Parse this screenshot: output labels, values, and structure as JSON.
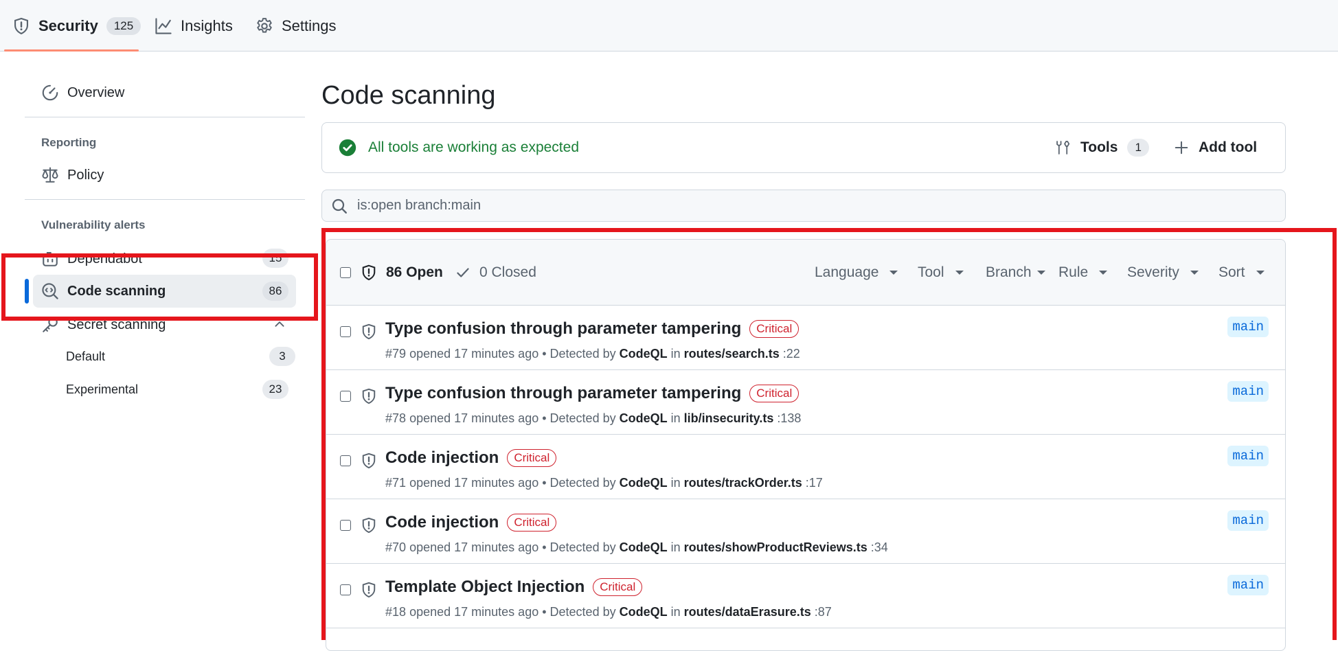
{
  "nav": {
    "tabs": [
      {
        "label": "Security",
        "count": "125",
        "icon": "shield-icon"
      },
      {
        "label": "Insights",
        "icon": "graph-icon"
      },
      {
        "label": "Settings",
        "icon": "gear-icon"
      }
    ]
  },
  "sidebar": {
    "overview": "Overview",
    "reporting_heading": "Reporting",
    "policy": "Policy",
    "vuln_heading": "Vulnerability alerts",
    "dependabot": {
      "label": "Dependabot",
      "count": "15"
    },
    "code_scanning": {
      "label": "Code scanning",
      "count": "86"
    },
    "secret_scanning": {
      "label": "Secret scanning"
    },
    "default": {
      "label": "Default",
      "count": "3"
    },
    "experimental": {
      "label": "Experimental",
      "count": "23"
    }
  },
  "main": {
    "title": "Code scanning",
    "status": "All tools are working as expected",
    "tools_label": "Tools",
    "tools_count": "1",
    "add_tool": "Add tool",
    "search_value": "is:open branch:main"
  },
  "list": {
    "open": "86 Open",
    "closed": "0 Closed",
    "filters": [
      "Language",
      "Tool",
      "Branch",
      "Rule",
      "Severity",
      "Sort"
    ],
    "rows": [
      {
        "title": "Type confusion through parameter tampering",
        "severity": "Critical",
        "number": "#79",
        "opened": "opened 17 minutes ago",
        "detected": "• Detected by",
        "tool": "CodeQL",
        "in": "in",
        "file": "routes/search.ts",
        "line": ":22",
        "branch": "main"
      },
      {
        "title": "Type confusion through parameter tampering",
        "severity": "Critical",
        "number": "#78",
        "opened": "opened 17 minutes ago",
        "detected": "• Detected by",
        "tool": "CodeQL",
        "in": "in",
        "file": "lib/insecurity.ts",
        "line": ":138",
        "branch": "main"
      },
      {
        "title": "Code injection",
        "severity": "Critical",
        "number": "#71",
        "opened": "opened 17 minutes ago",
        "detected": "• Detected by",
        "tool": "CodeQL",
        "in": "in",
        "file": "routes/trackOrder.ts",
        "line": ":17",
        "branch": "main"
      },
      {
        "title": "Code injection",
        "severity": "Critical",
        "number": "#70",
        "opened": "opened 17 minutes ago",
        "detected": "• Detected by",
        "tool": "CodeQL",
        "in": "in",
        "file": "routes/showProductReviews.ts",
        "line": ":34",
        "branch": "main"
      },
      {
        "title": "Template Object Injection",
        "severity": "Critical",
        "number": "#18",
        "opened": "opened 17 minutes ago",
        "detected": "• Detected by",
        "tool": "CodeQL",
        "in": "in",
        "file": "routes/dataErasure.ts",
        "line": ":87",
        "branch": "main"
      }
    ]
  },
  "colors": {
    "accent": "#0969da",
    "success": "#1a7f37",
    "danger": "#cf222e",
    "highlight": "#e5161c",
    "tab_underline": "#fd8c73"
  }
}
